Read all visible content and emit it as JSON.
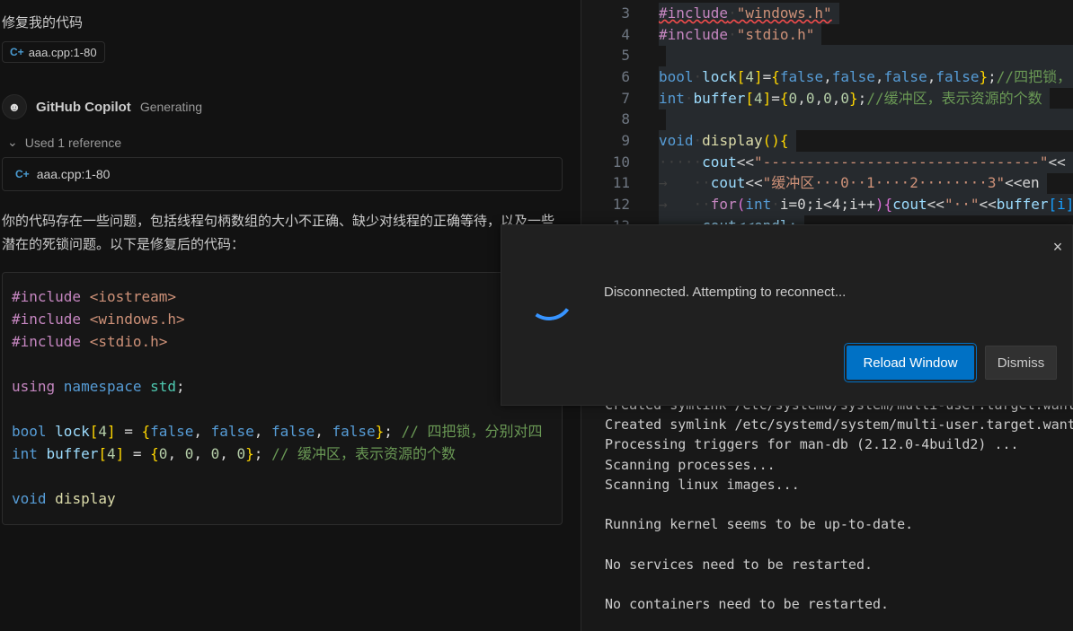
{
  "chat": {
    "request_text": "修复我的代码",
    "request_chip": "aaa.cpp:1-80",
    "agent_name": "GitHub Copilot",
    "agent_status": "Generating",
    "references_label": "Used 1 reference",
    "reference_file": "aaa.cpp:1-80",
    "response_text": "你的代码存在一些问题，包括线程句柄数组的大小不正确、缺少对线程的正确等待，以及一些潜在的死锁问题。以下是修复后的代码：",
    "code_lines": [
      [
        [
          "#include ",
          "pre"
        ],
        [
          "<iostream>",
          "str"
        ]
      ],
      [
        [
          "#include ",
          "pre"
        ],
        [
          "<windows.h>",
          "str"
        ]
      ],
      [
        [
          "#include ",
          "pre"
        ],
        [
          "<stdio.h>",
          "str"
        ]
      ],
      [],
      [
        [
          "using ",
          "pre"
        ],
        [
          "namespace ",
          "kw"
        ],
        [
          "std",
          "ty"
        ],
        [
          ";",
          "p"
        ]
      ],
      [],
      [
        [
          "bool ",
          "kw"
        ],
        [
          "lock",
          "id"
        ],
        [
          "[",
          "br"
        ],
        [
          "4",
          "num"
        ],
        [
          "]",
          "br"
        ],
        [
          " = ",
          "p"
        ],
        [
          "{",
          "br"
        ],
        [
          "false",
          "kw"
        ],
        [
          ", ",
          "p"
        ],
        [
          "false",
          "kw"
        ],
        [
          ", ",
          "p"
        ],
        [
          "false",
          "kw"
        ],
        [
          ", ",
          "p"
        ],
        [
          "false",
          "kw"
        ],
        [
          "}",
          "br"
        ],
        [
          "; ",
          "p"
        ],
        [
          "// 四把锁，分别对四",
          "cm"
        ]
      ],
      [
        [
          "int ",
          "kw"
        ],
        [
          "buffer",
          "id"
        ],
        [
          "[",
          "br"
        ],
        [
          "4",
          "num"
        ],
        [
          "]",
          "br"
        ],
        [
          " = ",
          "p"
        ],
        [
          "{",
          "br"
        ],
        [
          "0",
          "num"
        ],
        [
          ", ",
          "p"
        ],
        [
          "0",
          "num"
        ],
        [
          ", ",
          "p"
        ],
        [
          "0",
          "num"
        ],
        [
          ", ",
          "p"
        ],
        [
          "0",
          "num"
        ],
        [
          "}",
          "br"
        ],
        [
          "; ",
          "p"
        ],
        [
          "// 缓冲区，表示资源的个数",
          "cm"
        ]
      ],
      [],
      [
        [
          "void ",
          "kw"
        ],
        [
          "display",
          "fn"
        ]
      ]
    ]
  },
  "editor": {
    "lines": [
      {
        "n": "3",
        "t": [
          [
            "#include",
            "pre"
          ],
          [
            "·",
            "ws"
          ],
          [
            "\"windows.h\"",
            "str"
          ]
        ],
        "squiggle": true
      },
      {
        "n": "4",
        "t": [
          [
            "#include",
            "pre"
          ],
          [
            "·",
            "ws"
          ],
          [
            "\"stdio.h\"",
            "str"
          ]
        ]
      },
      {
        "n": "5",
        "t": []
      },
      {
        "n": "6",
        "t": [
          [
            "bool",
            "kw"
          ],
          [
            "·",
            "ws"
          ],
          [
            "lock",
            "id"
          ],
          [
            "[",
            "br"
          ],
          [
            "4",
            "num"
          ],
          [
            "]",
            "br"
          ],
          [
            "=",
            "p"
          ],
          [
            "{",
            "br"
          ],
          [
            "false",
            "kw"
          ],
          [
            ",",
            "p"
          ],
          [
            "false",
            "kw"
          ],
          [
            ",",
            "p"
          ],
          [
            "false",
            "kw"
          ],
          [
            ",",
            "p"
          ],
          [
            "false",
            "kw"
          ],
          [
            "}",
            "br"
          ],
          [
            ";",
            "p"
          ],
          [
            "//四把锁，",
            "cm"
          ]
        ]
      },
      {
        "n": "7",
        "t": [
          [
            "int",
            "kw"
          ],
          [
            "·",
            "ws"
          ],
          [
            "buffer",
            "id"
          ],
          [
            "[",
            "br"
          ],
          [
            "4",
            "num"
          ],
          [
            "]",
            "br"
          ],
          [
            "=",
            "p"
          ],
          [
            "{",
            "br"
          ],
          [
            "0",
            "num"
          ],
          [
            ",",
            "p"
          ],
          [
            "0",
            "num"
          ],
          [
            ",",
            "p"
          ],
          [
            "0",
            "num"
          ],
          [
            ",",
            "p"
          ],
          [
            "0",
            "num"
          ],
          [
            "}",
            "br"
          ],
          [
            ";",
            "p"
          ],
          [
            "//缓冲区，表示资源的个数",
            "cm"
          ]
        ]
      },
      {
        "n": "8",
        "t": []
      },
      {
        "n": "9",
        "t": [
          [
            "void",
            "kw"
          ],
          [
            "·",
            "ws"
          ],
          [
            "display",
            "fn"
          ],
          [
            "()",
            "br"
          ],
          [
            "{",
            "br"
          ]
        ]
      },
      {
        "n": "10",
        "t": [
          [
            "·····",
            "ws"
          ],
          [
            "cout",
            "id"
          ],
          [
            "<<",
            "p"
          ],
          [
            "\"--------------------------------\"",
            "str"
          ],
          [
            "<<",
            "p"
          ]
        ]
      },
      {
        "n": "11",
        "t": [
          [
            "→   ··",
            "ws"
          ],
          [
            "cout",
            "id"
          ],
          [
            "<<",
            "p"
          ],
          [
            "\"缓冲区···0··1····2········3\"",
            "str"
          ],
          [
            "<<en",
            "p"
          ]
        ]
      },
      {
        "n": "12",
        "t": [
          [
            "→   ··",
            "ws"
          ],
          [
            "for",
            "ctl"
          ],
          [
            "(",
            "br2"
          ],
          [
            "int",
            "kw"
          ],
          [
            "·",
            "ws"
          ],
          [
            "i=0;i<4;i++",
            "p"
          ],
          [
            ")",
            "br2"
          ],
          [
            "{",
            "br2"
          ],
          [
            "cout",
            "id"
          ],
          [
            "<<",
            "p"
          ],
          [
            "\"··\"",
            "str"
          ],
          [
            "<<",
            "p"
          ],
          [
            "buffer",
            "id"
          ],
          [
            "[i]",
            "br3"
          ]
        ]
      },
      {
        "n": "13",
        "t": [
          [
            "·····",
            "ws"
          ],
          [
            "cout<<endl;",
            "id"
          ]
        ]
      }
    ]
  },
  "terminal": {
    "lines": [
      "Created symlink /etc/systemd/system/multi-user.target.wants",
      "Created symlink /etc/systemd/system/multi-user.target.wants",
      "Processing triggers for man-db (2.12.0-4build2) ...",
      "Scanning processes...",
      "Scanning linux images...",
      "",
      "Running kernel seems to be up-to-date.",
      "",
      "No services need to be restarted.",
      "",
      "No containers need to be restarted."
    ]
  },
  "notification": {
    "message": "Disconnected. Attempting to reconnect...",
    "primary_button": "Reload Window",
    "secondary_button": "Dismiss",
    "close_icon": "×",
    "accent_color": "#0071c5"
  }
}
